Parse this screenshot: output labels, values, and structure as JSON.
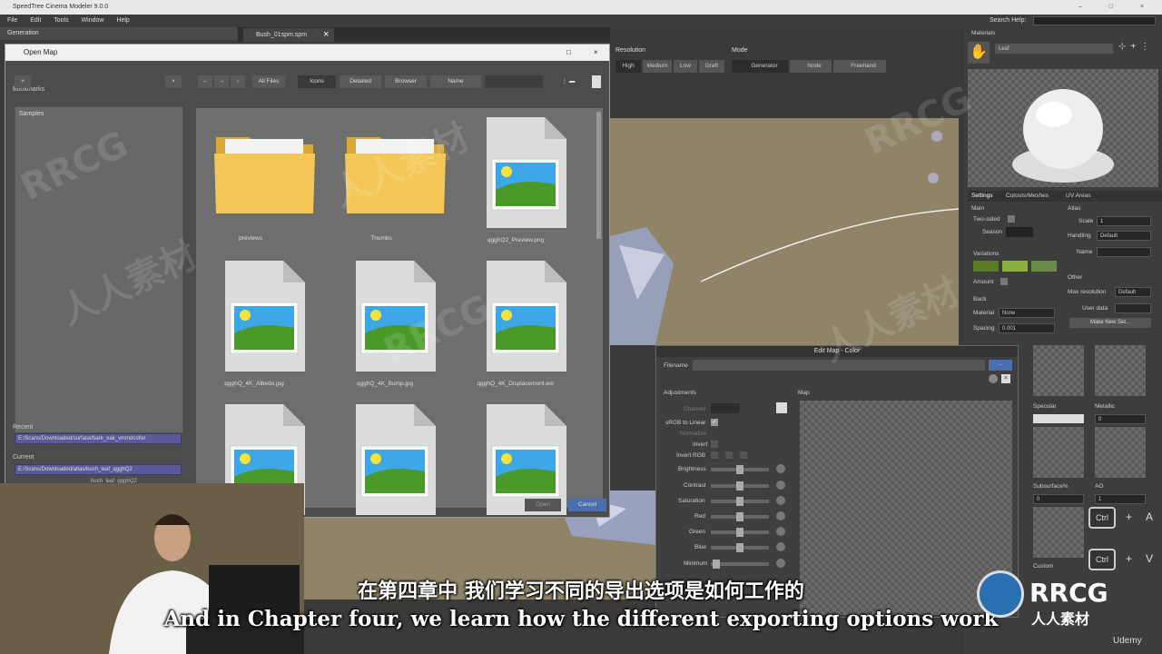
{
  "app": {
    "title": "SpeedTree Cinema Modeler 9.0.0",
    "window_controls": "– □ ×",
    "menu": [
      "File",
      "Edit",
      "Tools",
      "Window",
      "Help"
    ],
    "search_label": "Search Help:"
  },
  "generation_panel": {
    "title": "Generation"
  },
  "document_tab": {
    "label": "Bush_01spm.spm"
  },
  "toolbar": {
    "resolution_label": "Resolution",
    "resolution_options": [
      "High",
      "Medium",
      "Low",
      "Draft"
    ],
    "mode_label": "Mode",
    "mode_options": [
      "Generator",
      "Node",
      "Freehand"
    ]
  },
  "open_map_dialog": {
    "title": "Open Map",
    "bookmarks_label": "Bookmarks",
    "add_button": "+",
    "remove_button": "×",
    "bookmark_items": [
      "Samples"
    ],
    "filter_all_files": "All Files",
    "view_icons": "Icons",
    "view_detailed": "Detailed",
    "view_browser": "Browser",
    "sort_by": "Name",
    "recent_label": "Recent",
    "recent_value": "E:/Scans/Downloaded/surface/bark_oak_vmmdcofw/",
    "current_label": "Current",
    "current_value": "E:/Scans/Downloaded/atlas/bush_leaf_qgghQ2",
    "current_subvalue": "bush_leaf_qgghQ2",
    "open_button": "Open",
    "cancel_button": "Cancel",
    "files": [
      {
        "name": "previews",
        "type": "folder"
      },
      {
        "name": "Thumbs",
        "type": "folder"
      },
      {
        "name": "qgghQ2_Preview.png",
        "type": "image"
      },
      {
        "name": "qgghQ_4K_Albedo.jpg",
        "type": "image"
      },
      {
        "name": "qgghQ_4K_Bump.jpg",
        "type": "image"
      },
      {
        "name": "qgghQ_4K_Displacement.exr",
        "type": "image"
      },
      {
        "name": "",
        "type": "image"
      },
      {
        "name": "",
        "type": "image"
      },
      {
        "name": "",
        "type": "image"
      }
    ]
  },
  "materials_panel": {
    "title": "Materials",
    "material_name": "Leaf",
    "tabs": [
      "Settings",
      "Cutouts/Meshes",
      "UV Areas"
    ],
    "main_label": "Main",
    "two_sided_label": "Two-sided",
    "season_label": "Season",
    "variations_label": "Variations",
    "amount_label": "Amount",
    "back_label": "Back",
    "material_label": "Material",
    "material_value": "None",
    "spacing_label": "Spacing",
    "spacing_value": "0.001",
    "atlas_label": "Atlas",
    "scale_label": "Scale",
    "scale_value": "1",
    "handling_label": "Handling",
    "handling_value": "Default",
    "name_label": "Name",
    "other_label": "Other",
    "max_resolution_label": "Max resolution",
    "max_resolution_value": "Default",
    "user_data_label": "User data",
    "make_new_set_button": "Make New Set...",
    "specular_label": "Specular",
    "metallic_label": "Metallic",
    "metallic_value": "0",
    "subsurface_label": "Subsurface%",
    "subsurface_value": "0",
    "ao_label": "AO",
    "ao_value": "1",
    "custom_label": "Custom",
    "variation_colors": [
      "#5a7a2a",
      "#8ab040",
      "#6a8a4a"
    ]
  },
  "edit_map_dialog": {
    "title": "Edit Map - Color",
    "filename_label": "Filename",
    "browse_button": "...",
    "adjustments_label": "Adjustments",
    "map_label": "Map",
    "channel_label": "Channel",
    "srgb_label": "sRGB to Linear",
    "normalize_label": "Normalize",
    "invert_label": "Invert",
    "invert_rgb_label": "Invert RGB",
    "sliders": [
      "Brightness",
      "Contrast",
      "Saturation",
      "Red",
      "Green",
      "Blue",
      "Minimum"
    ]
  },
  "keycaps": [
    "Ctrl",
    "+",
    "A",
    "Ctrl",
    "+",
    "V"
  ],
  "subtitles": {
    "chinese": "在第四章中 我们学习不同的导出选项是如何工作的",
    "english": "And in Chapter four, we learn how the different exporting options work"
  },
  "watermarks": [
    "RRCG",
    "人人素材",
    "RRCG",
    "人人素材",
    "RRCG",
    "人人素材"
  ],
  "logo": {
    "text": "RRCG",
    "subtext": "人人素材",
    "udemy": "Udemy"
  }
}
